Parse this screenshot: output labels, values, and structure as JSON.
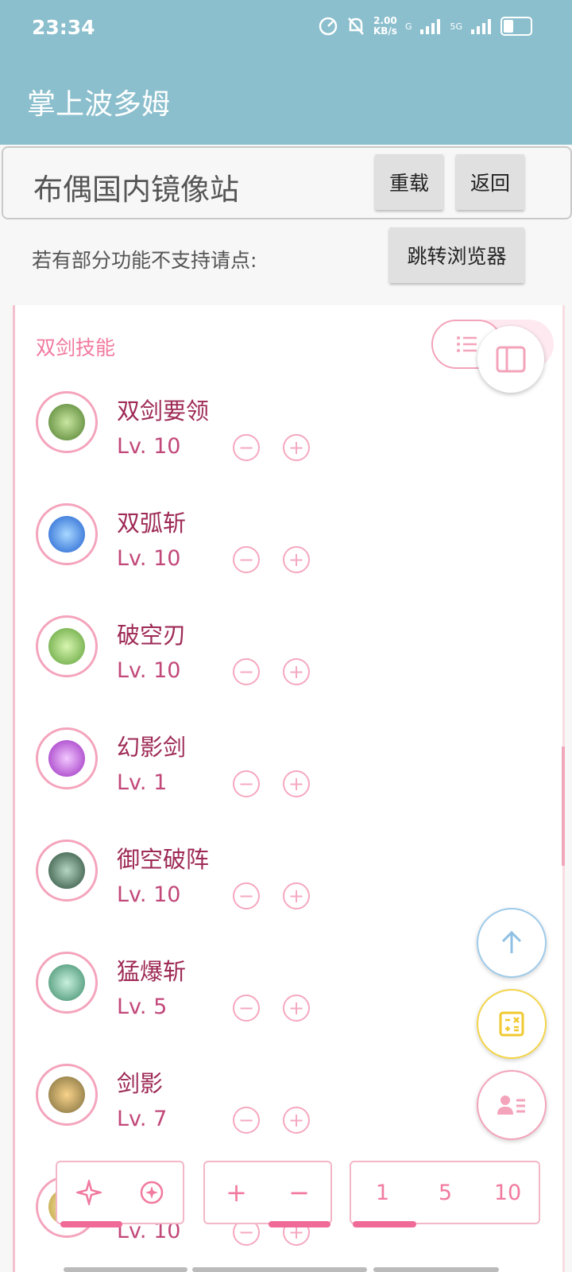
{
  "status_bar": {
    "time": "23:34",
    "network_speed": "2.00",
    "network_unit": "KB/s",
    "net_label_1": "G",
    "net_label_2": "5G"
  },
  "app_bar": {
    "title": "掌上波多姆"
  },
  "url_bar": {
    "site_name": "布偶国内镜像站",
    "reload_label": "重载",
    "back_label": "返回"
  },
  "hint": {
    "text": "若有部分功能不支持请点:",
    "browser_button_label": "跳转浏览器"
  },
  "section": {
    "title": "双剑技能"
  },
  "skills": [
    {
      "name": "双剑要领",
      "level": "Lv. 10",
      "icon": "crossed-swords-icon"
    },
    {
      "name": "双弧斩",
      "level": "Lv. 10",
      "icon": "arc-slash-icon"
    },
    {
      "name": "破空刃",
      "level": "Lv. 10",
      "icon": "sky-blade-icon"
    },
    {
      "name": "幻影剑",
      "level": "Lv. 1",
      "icon": "phantom-skull-icon"
    },
    {
      "name": "御空破阵",
      "level": "Lv. 10",
      "icon": "shield-formation-icon"
    },
    {
      "name": "猛爆斩",
      "level": "Lv. 5",
      "icon": "burst-slash-icon"
    },
    {
      "name": "剑影",
      "level": "Lv. 7",
      "icon": "sword-shadow-icon"
    },
    {
      "name": "",
      "level": "Lv. 10",
      "icon": "partial-skill-icon"
    }
  ],
  "bottom_bar": {
    "step_options": [
      "1",
      "5",
      "10"
    ],
    "plus_label": "+",
    "minus_label": "−"
  },
  "colors": {
    "header_bg": "#8bbfcd",
    "pink_accent": "#f17a9f",
    "skill_name": "#9e2a56",
    "fab_up": "#9fcbea",
    "fab_calc": "#f3d54a",
    "fab_profile": "#f3a3ba"
  }
}
